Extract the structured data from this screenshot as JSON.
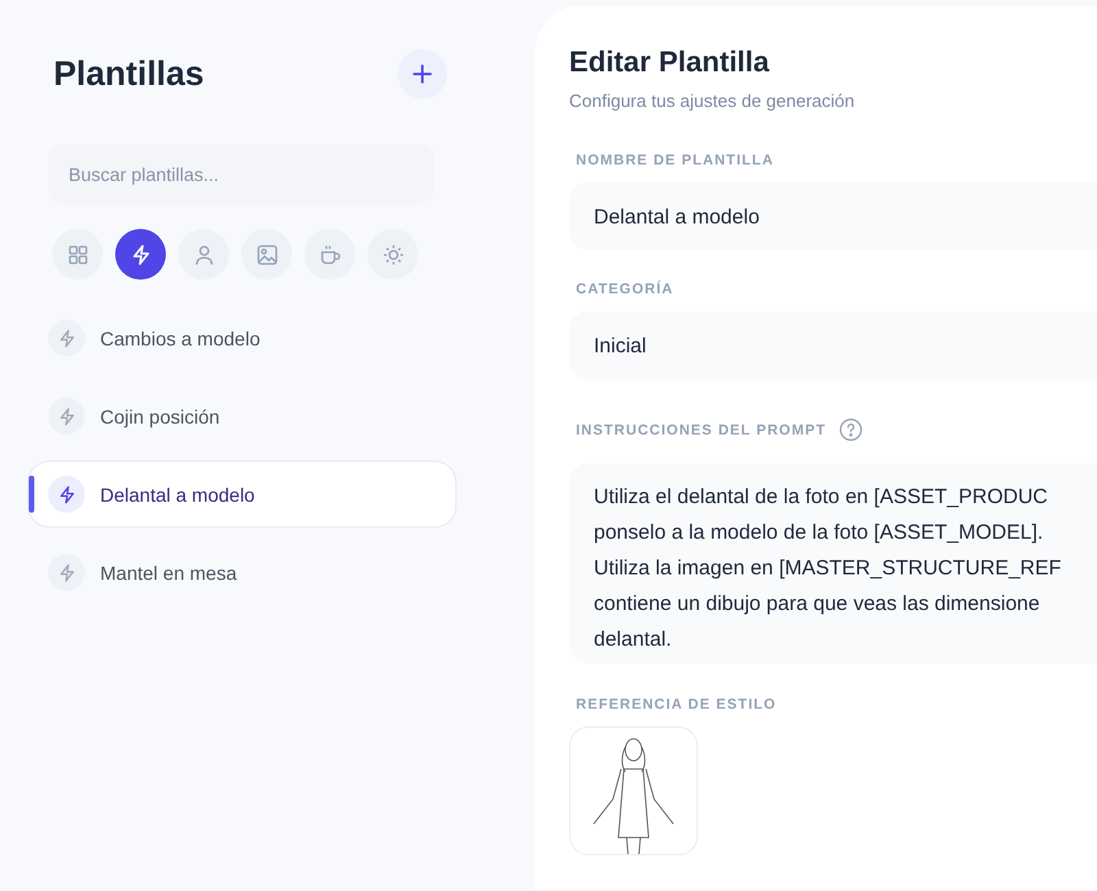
{
  "sidebar": {
    "title": "Plantillas",
    "search": {
      "placeholder": "Buscar plantillas..."
    },
    "filters": [
      {
        "kind": "grid",
        "selected": false
      },
      {
        "kind": "bolt",
        "selected": true
      },
      {
        "kind": "person",
        "selected": false
      },
      {
        "kind": "image",
        "selected": false
      },
      {
        "kind": "cup",
        "selected": false
      },
      {
        "kind": "sun",
        "selected": false
      }
    ],
    "items": [
      {
        "label": "Cambios a modelo",
        "selected": false
      },
      {
        "label": "Cojin posición",
        "selected": false
      },
      {
        "label": "Delantal a modelo",
        "selected": true
      },
      {
        "label": "Mantel en mesa",
        "selected": false
      }
    ]
  },
  "editor": {
    "title": "Editar Plantilla",
    "subtitle": "Configura tus ajustes de generación",
    "name_label": "NOMBRE DE PLANTILLA",
    "name_value": "Delantal a modelo",
    "category_label": "CATEGORÍA",
    "category_value": "Inicial",
    "prompt_label": "INSTRUCCIONES DEL PROMPT",
    "prompt_lines": [
      "Utiliza el delantal de la foto en [ASSET_PRODUC",
      "ponselo a la modelo de la foto [ASSET_MODEL].",
      "Utiliza la imagen en [MASTER_STRUCTURE_REF",
      "contiene un dibujo para que veas las dimensione",
      "delantal."
    ],
    "style_label": "REFERENCIA DE ESTILO"
  }
}
